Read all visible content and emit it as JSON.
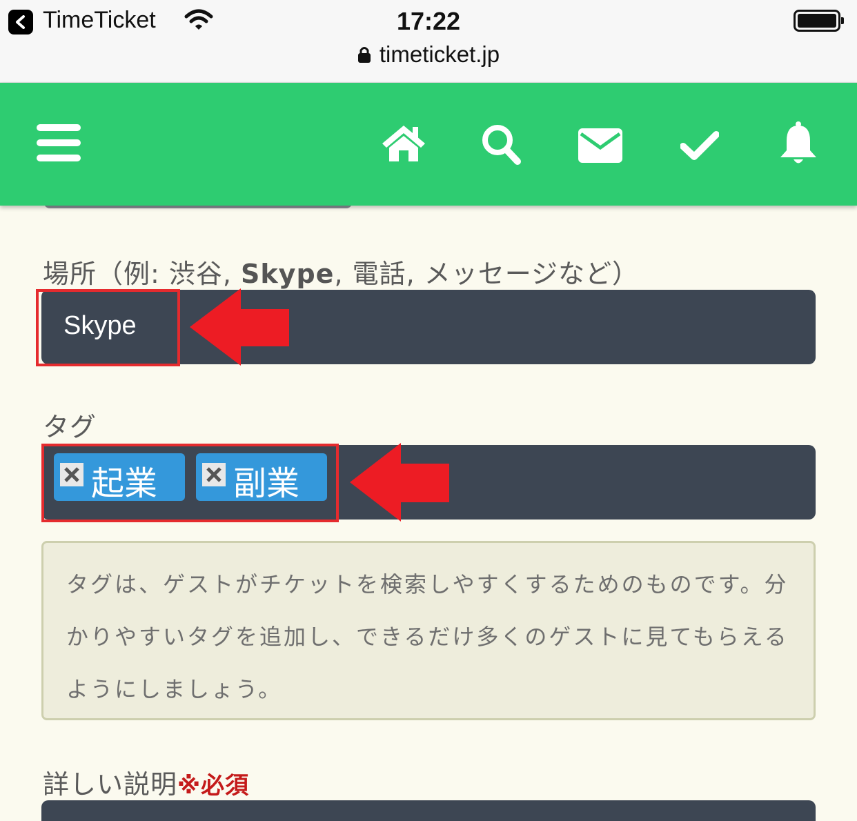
{
  "statusbar": {
    "back_app": "TimeTicket",
    "time": "17:22",
    "url": "timeticket.jp"
  },
  "navbar": {
    "icons": [
      "hamburger-menu-icon",
      "home-icon",
      "search-icon",
      "envelope-icon",
      "check-icon",
      "bell-icon"
    ],
    "color": "#2ecc71"
  },
  "location": {
    "label_prefix": "場所（例: 渋谷, ",
    "label_bold": "Skype",
    "label_suffix": ", 電話, メッセージなど）",
    "value": "Skype"
  },
  "tags": {
    "label": "タグ",
    "items": [
      "起業",
      "副業"
    ],
    "help": "タグは、ゲストがチケットを検索しやすくするためのものです。分かりやすいタグを追加し、できるだけ多くのゲストに見てもらえるようにしましょう。"
  },
  "description": {
    "label": "詳しい説明",
    "required": "※必須"
  },
  "colors": {
    "field_bg": "#3d4653",
    "tag_bg": "#3498db",
    "highlight": "#e52b2e",
    "page_bg": "#fbfaef"
  }
}
